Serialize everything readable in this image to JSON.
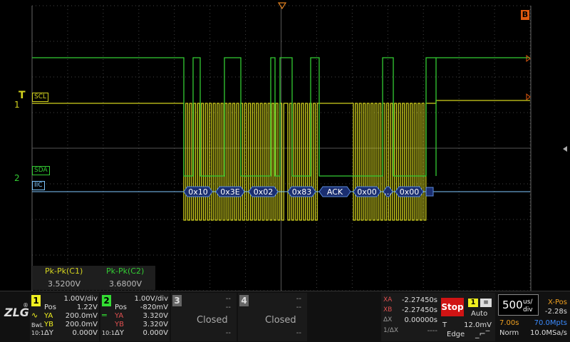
{
  "colors": {
    "ch1": "#d4d41e",
    "ch2": "#33cc33",
    "bus": "#3b8bff",
    "stop": "#d01414",
    "grid": "#444444"
  },
  "waveform": {
    "scl_label": "SCL",
    "sda_label": "SDA",
    "bus_label": "IIC",
    "ch1_marker": "1",
    "ch2_marker": "2",
    "trigger_marker": "T",
    "right_marker": "B",
    "decode": [
      "0x10",
      "0x3E",
      "0x02",
      "0x83",
      "ACK",
      "0x00",
      "…",
      "0x00"
    ]
  },
  "measure": {
    "c1_label": "Pk-Pk(C1)",
    "c2_label": "Pk-Pk(C2)",
    "c1_value": "3.5200V",
    "c2_value": "3.6800V"
  },
  "ch1": {
    "num": "1",
    "scale": "1.00V/div",
    "pos_label": "Pos",
    "pos": "1.22V",
    "ya_label": "YA",
    "ya": "200.0mV",
    "yb_label": "YB",
    "yb": "200.0mV",
    "dy_label": "ΔY",
    "dy": "0.000V",
    "bw": "BwL",
    "probe": "10:1"
  },
  "ch2": {
    "num": "2",
    "scale": "1.00V/div",
    "pos_label": "Pos",
    "pos": "-820mV",
    "ya_label": "YA",
    "ya": "3.320V",
    "yb_label": "YB",
    "yb": "3.320V",
    "dy_label": "ΔY",
    "dy": "0.000V",
    "probe": "10:1"
  },
  "ch3": {
    "num": "3",
    "state": "Closed",
    "dash": "--"
  },
  "ch4": {
    "num": "4",
    "state": "Closed",
    "dash": "--"
  },
  "cursor": {
    "xa_label": "XA",
    "xa": "-2.27450s",
    "xb_label": "XB",
    "xb": "-2.27450s",
    "dx_label": "ΔX",
    "dx": "0.00000s",
    "inv_label": "1/ΔX",
    "inv": "----"
  },
  "trigger": {
    "run_state": "Stop",
    "source": "1",
    "mode": "Auto",
    "t_label": "T",
    "level": "12.0mV",
    "type": "Edge"
  },
  "timebase": {
    "scale": "500",
    "unit_top": "us/",
    "unit_bot": "div",
    "xpos_label": "X-Pos",
    "xpos": "-2.28s",
    "duration": "7.00s",
    "memory": "70.0Mpts",
    "acq": "Norm",
    "rate": "10.0MSa/s"
  },
  "logo": "ZLG"
}
